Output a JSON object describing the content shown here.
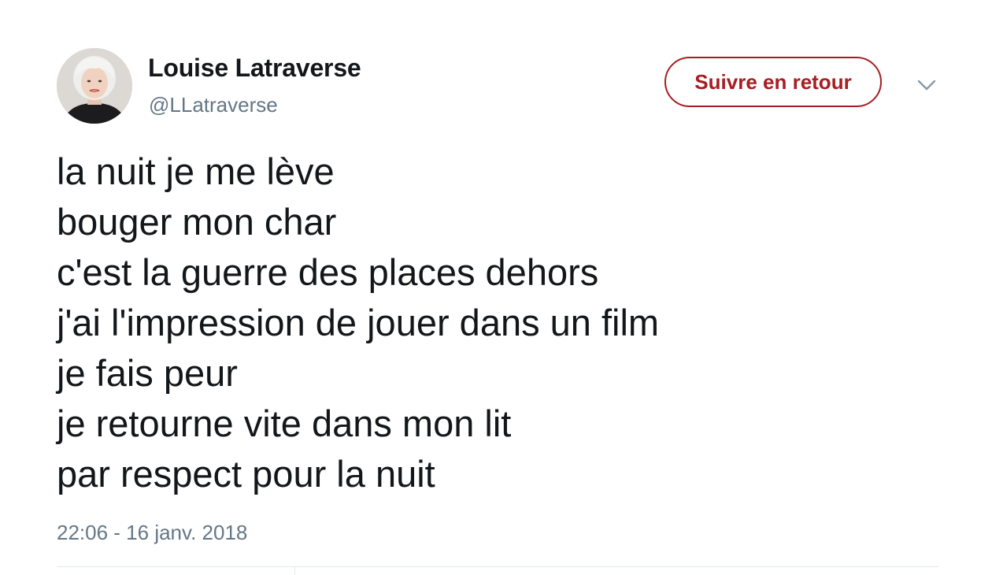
{
  "author": {
    "display_name": "Louise Latraverse",
    "handle": "@LLatraverse",
    "avatar_icon": "profile-photo"
  },
  "follow_button": {
    "label": "Suivre en retour",
    "color": "#a61e22"
  },
  "menu": {
    "icon": "chevron-down-icon"
  },
  "tweet": {
    "lines": [
      "la nuit je me lève",
      "bouger mon char",
      "c'est la guerre des places dehors",
      "j'ai l'impression de jouer dans un film",
      "je fais peur",
      "je retourne vite dans mon lit",
      "par respect pour la nuit"
    ],
    "timestamp": "22:06 - 16 janv. 2018"
  }
}
